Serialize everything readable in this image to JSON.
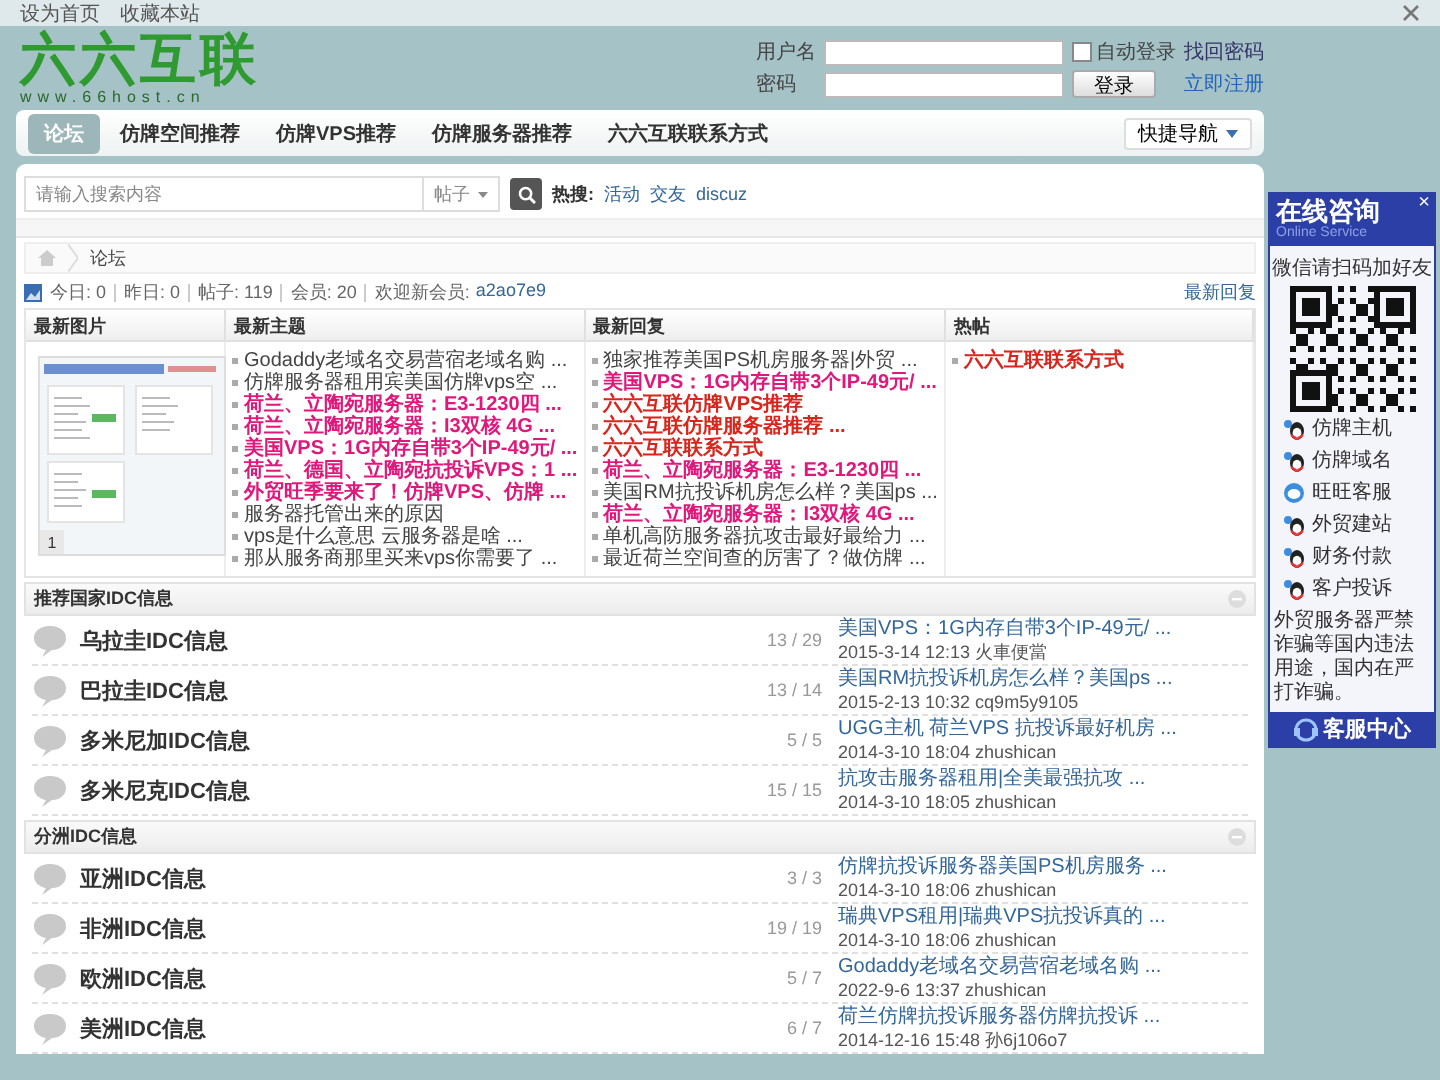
{
  "top_bar": {
    "links": [
      "设为首页",
      "收藏本站"
    ]
  },
  "header": {
    "logo": "六六互联",
    "logo_url": "www.66host.cn",
    "login": {
      "username_label": "用户名",
      "password_label": "密码",
      "auto_login_label": "自动登录",
      "auto_login_checked": false,
      "forgot_password": "找回密码",
      "register": "立即注册",
      "login_button": "登录"
    }
  },
  "nav": {
    "items": [
      {
        "label": "论坛",
        "selected": true
      },
      {
        "label": "仿牌空间推荐",
        "selected": false
      },
      {
        "label": "仿牌VPS推荐",
        "selected": false
      },
      {
        "label": "仿牌服务器推荐",
        "selected": false
      },
      {
        "label": "六六互联联系方式",
        "selected": false
      }
    ],
    "quick_nav": "快捷导航"
  },
  "search": {
    "placeholder": "请输入搜索内容",
    "scope": "帖子",
    "hot_label": "热搜:",
    "hot_links": [
      "活动",
      "交友",
      "discuz"
    ]
  },
  "breadcrumb": [
    "论坛"
  ],
  "stats": {
    "items": [
      "今日: 0",
      "昨日: 0",
      "帖子: 119",
      "会员: 20"
    ],
    "new_member_label": "欢迎新会员:",
    "new_member": "a2ao7e9",
    "latest_replies_link": "最新回复"
  },
  "overview": {
    "columns": [
      "最新图片",
      "最新主题",
      "最新回复",
      "热帖"
    ],
    "image_pager": "1",
    "new_topics": [
      {
        "title": "Godaddy老域名交易营宿老域名购 ...",
        "color": "#444444",
        "bold": false
      },
      {
        "title": "仿牌服务器租用宾美国仿牌vps空 ...",
        "color": "#444444",
        "bold": false
      },
      {
        "title": "荷兰、立陶宛服务器：E3-1230四 ...",
        "color": "#e0187c",
        "bold": true
      },
      {
        "title": "荷兰、立陶宛服务器：I3双核 4G ...",
        "color": "#e0187c",
        "bold": true
      },
      {
        "title": "美国VPS：1G内存自带3个IP-49元/ ...",
        "color": "#e0187c",
        "bold": true
      },
      {
        "title": "荷兰、德国、立陶宛抗投诉VPS：1 ...",
        "color": "#e0187c",
        "bold": true
      },
      {
        "title": "外贸旺季要来了！仿牌VPS、仿牌 ...",
        "color": "#e0187c",
        "bold": true
      },
      {
        "title": "服务器托管出来的原因",
        "color": "#444444",
        "bold": false
      },
      {
        "title": "vps是什么意思 云服务器是啥 ...",
        "color": "#444444",
        "bold": false
      },
      {
        "title": "那从服务商那里买来vps你需要了 ...",
        "color": "#444444",
        "bold": false
      }
    ],
    "new_replies": [
      {
        "title": "独家推荐美国PS机房服务器|外贸 ...",
        "color": "#444444",
        "bold": false
      },
      {
        "title": "美国VPS：1G内存自带3个IP-49元/ ...",
        "color": "#e0187c",
        "bold": true
      },
      {
        "title": "六六互联仿牌VPS推荐",
        "color": "#d9261c",
        "bold": true
      },
      {
        "title": "六六互联仿牌服务器推荐 ...",
        "color": "#d9261c",
        "bold": true
      },
      {
        "title": "六六互联联系方式",
        "color": "#d9261c",
        "bold": true
      },
      {
        "title": "荷兰、立陶宛服务器：E3-1230四 ...",
        "color": "#e0187c",
        "bold": true
      },
      {
        "title": "美国RM抗投诉机房怎么样？美国ps ...",
        "color": "#444444",
        "bold": false
      },
      {
        "title": "荷兰、立陶宛服务器：I3双核 4G ...",
        "color": "#e0187c",
        "bold": true
      },
      {
        "title": "单机高防服务器抗攻击最好最给力 ...",
        "color": "#444444",
        "bold": false
      },
      {
        "title": "最近荷兰空间查的厉害了？做仿牌 ...",
        "color": "#444444",
        "bold": false
      }
    ],
    "hot_posts": [
      {
        "title": "六六互联联系方式",
        "color": "#d9261c",
        "bold": true
      }
    ]
  },
  "sections": [
    {
      "title": "推荐国家IDC信息",
      "forums": [
        {
          "name": "乌拉圭IDC信息",
          "counts": "13 / 29",
          "last_post_title": "美国VPS：1G内存自带3个IP-49元/ ...",
          "last_post_meta": "2015-3-14 12:13 火車便當"
        },
        {
          "name": "巴拉圭IDC信息",
          "counts": "13 / 14",
          "last_post_title": "美国RM抗投诉机房怎么样？美国ps ...",
          "last_post_meta": "2015-2-13 10:32 cq9m5y9105"
        },
        {
          "name": "多米尼加IDC信息",
          "counts": "5 / 5",
          "last_post_title": "UGG主机 荷兰VPS 抗投诉最好机房 ...",
          "last_post_meta": "2014-3-10 18:04 zhushican"
        },
        {
          "name": "多米尼克IDC信息",
          "counts": "15 / 15",
          "last_post_title": "抗攻击服务器租用|全美最强抗攻 ...",
          "last_post_meta": "2014-3-10 18:05 zhushican"
        }
      ]
    },
    {
      "title": "分洲IDC信息",
      "forums": [
        {
          "name": "亚洲IDC信息",
          "counts": "3 / 3",
          "last_post_title": "仿牌抗投诉服务器美国PS机房服务 ...",
          "last_post_meta": "2014-3-10 18:06 zhushican"
        },
        {
          "name": "非洲IDC信息",
          "counts": "19 / 19",
          "last_post_title": "瑞典VPS租用|瑞典VPS抗投诉真的 ...",
          "last_post_meta": "2014-3-10 18:06 zhushican"
        },
        {
          "name": "欧洲IDC信息",
          "counts": "5 / 7",
          "last_post_title": "Godaddy老域名交易营宿老域名购 ...",
          "last_post_meta": "2022-9-6 13:37 zhushican"
        },
        {
          "name": "美洲IDC信息",
          "counts": "6 / 7",
          "last_post_title": "荷兰仿牌抗投诉服务器仿牌抗投诉 ...",
          "last_post_meta": "2014-12-16 15:48 孙6j106o7"
        }
      ]
    }
  ],
  "side_widget": {
    "title": "在线咨询",
    "subtitle": "Online Service",
    "close": "×",
    "wechat_hint": "微信请扫码加好友",
    "contacts": [
      {
        "label": "仿牌主机",
        "kind": "qq"
      },
      {
        "label": "仿牌域名",
        "kind": "qq"
      },
      {
        "label": "旺旺客服",
        "kind": "wangwang"
      },
      {
        "label": "外贸建站",
        "kind": "qq"
      },
      {
        "label": "财务付款",
        "kind": "qq"
      },
      {
        "label": "客户投诉",
        "kind": "qq"
      }
    ],
    "notice": "外贸服务器严禁诈骗等国内违法用途，国内在严打诈骗。",
    "footer": "客服中心"
  }
}
